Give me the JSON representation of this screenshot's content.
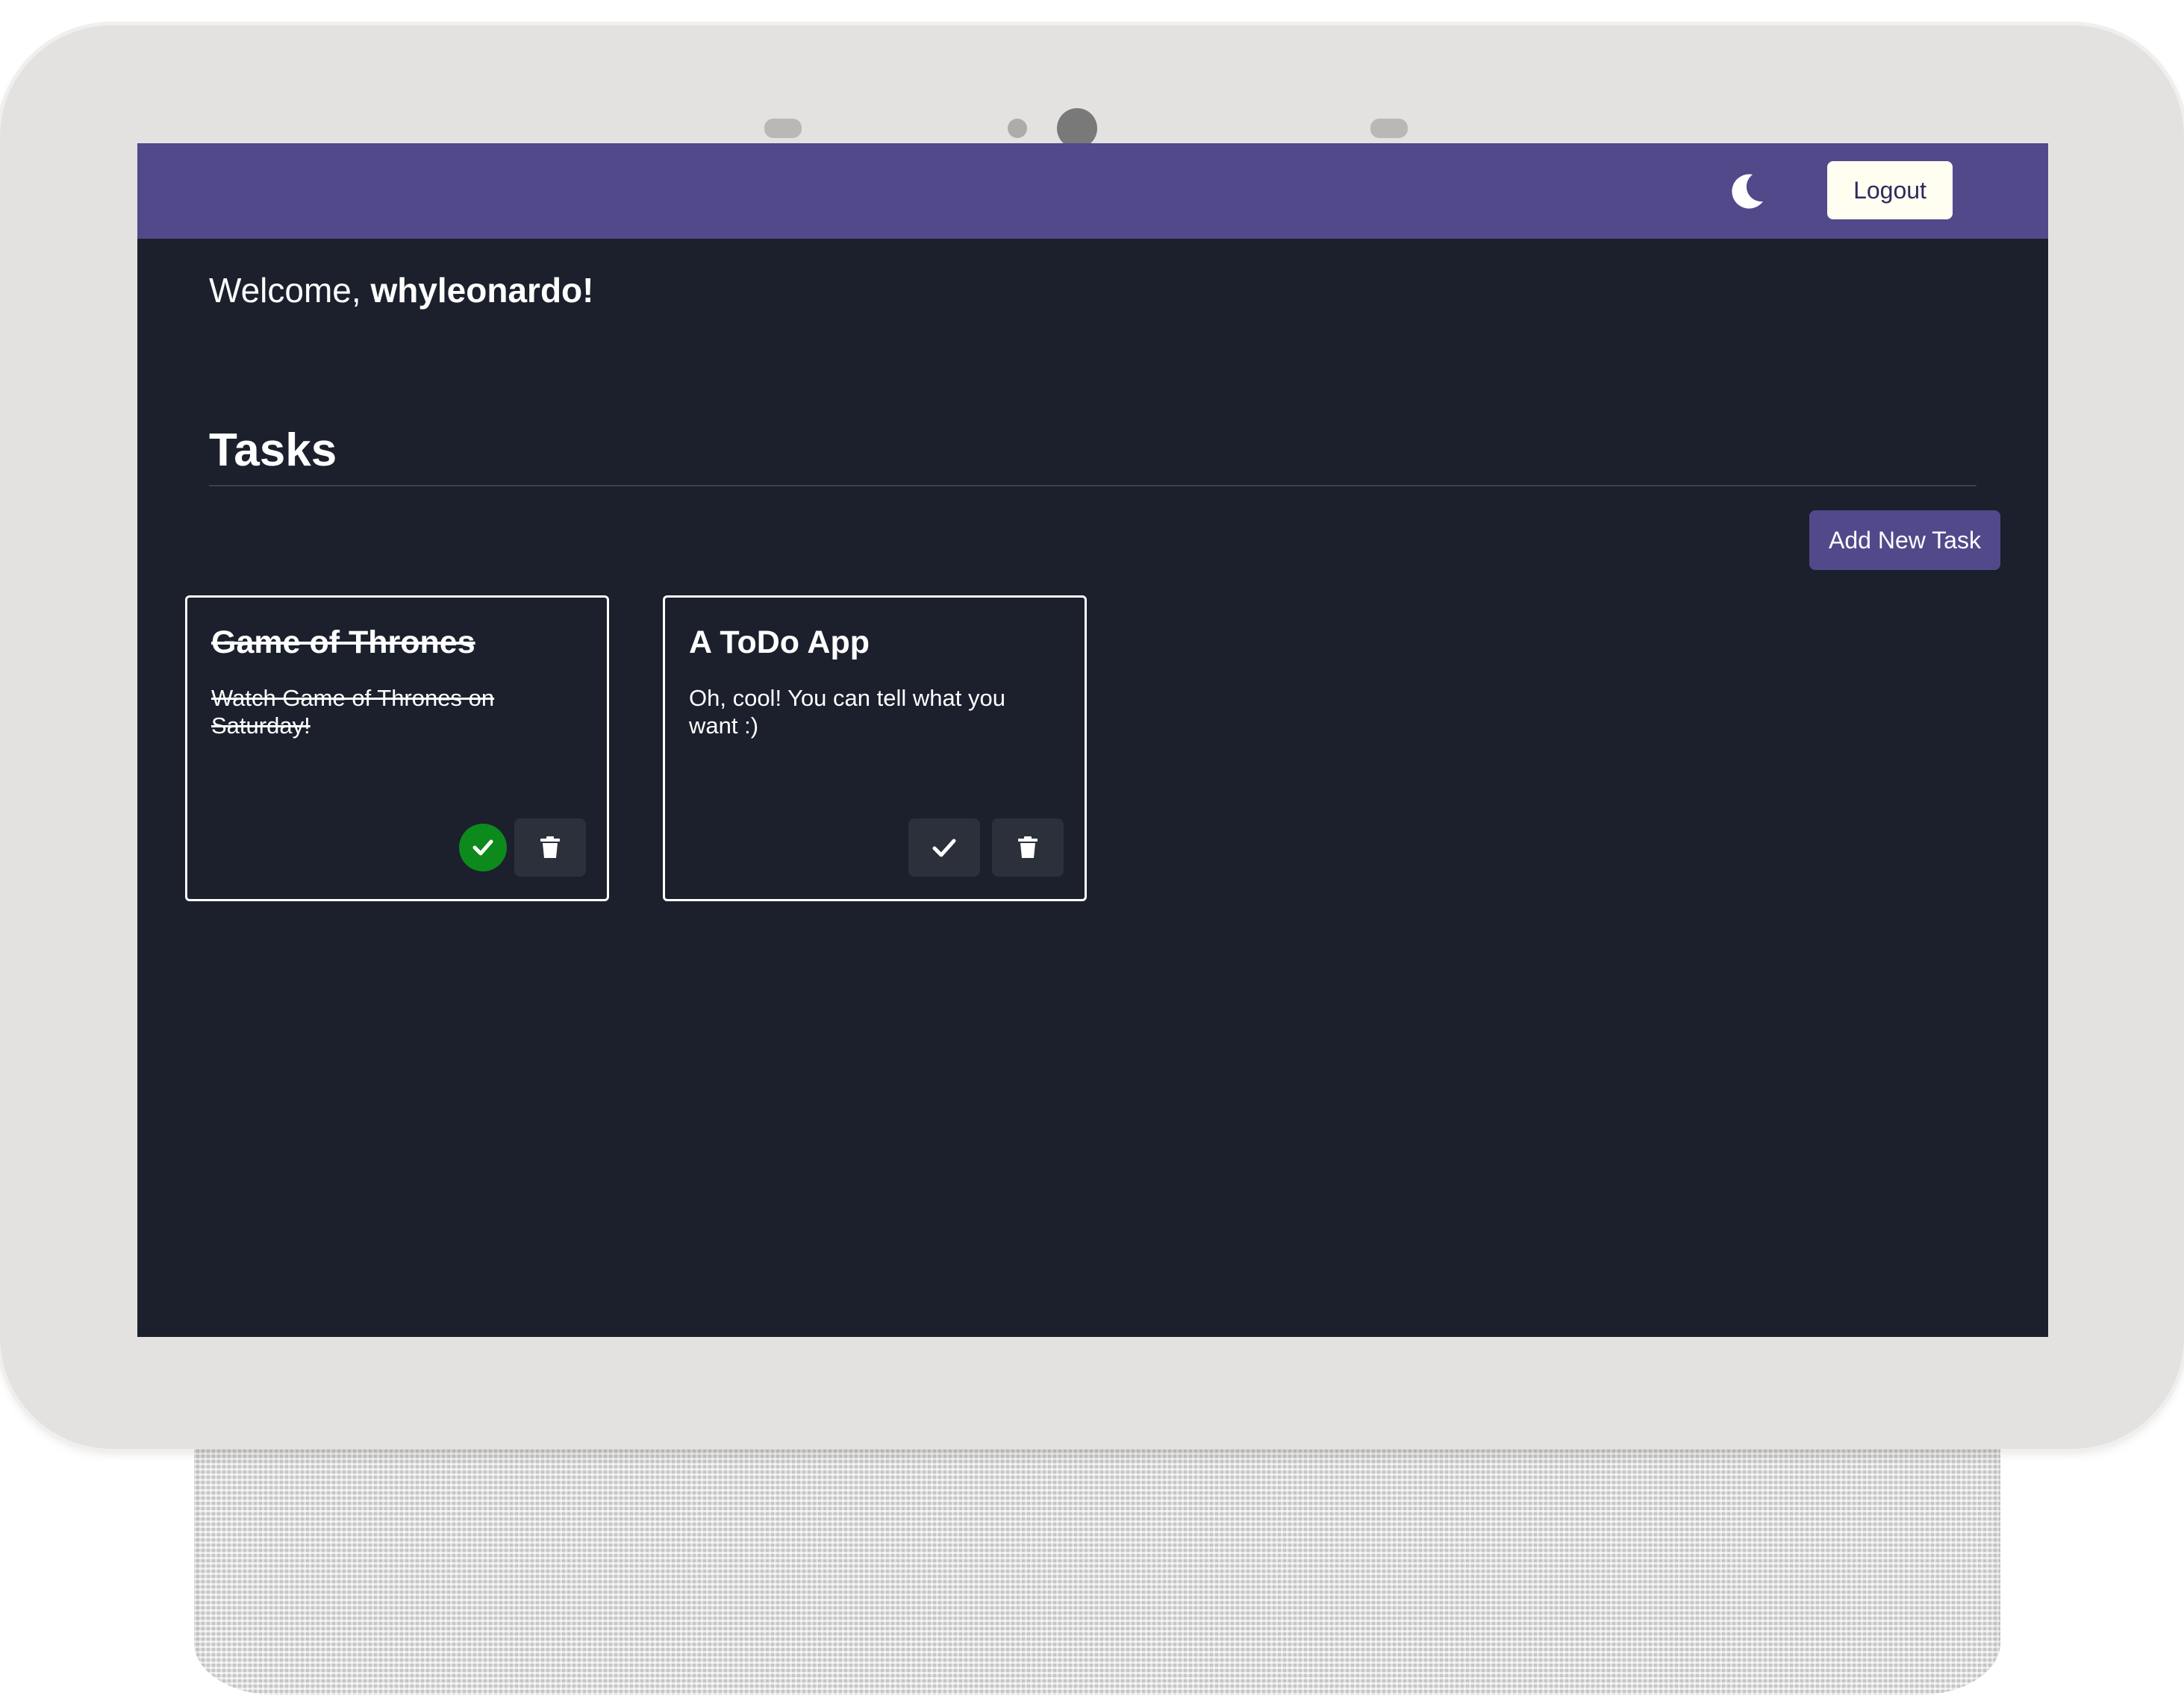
{
  "colors": {
    "navbar": "#52498b",
    "screen_background": "#1b202c",
    "accent_button": "#52498b",
    "logout_button_bg": "#fffef1",
    "done_indicator": "#0c8a1c",
    "card_border": "#ffffff"
  },
  "navbar": {
    "theme_toggle_icon": "moon-icon",
    "logout_label": "Logout"
  },
  "welcome": {
    "greeting": "Welcome, ",
    "username": "whyleonardo!"
  },
  "tasks": {
    "heading": "Tasks",
    "add_button_label": "Add New Task",
    "items": [
      {
        "title": "Game of Thrones",
        "description": "Watch Game of Thrones on Saturday!",
        "completed": true,
        "complete_icon": "check-icon",
        "delete_icon": "trash-icon"
      },
      {
        "title": "A ToDo App",
        "description": "Oh, cool! You can tell what you want :)",
        "completed": false,
        "complete_icon": "check-icon",
        "delete_icon": "trash-icon"
      }
    ]
  }
}
